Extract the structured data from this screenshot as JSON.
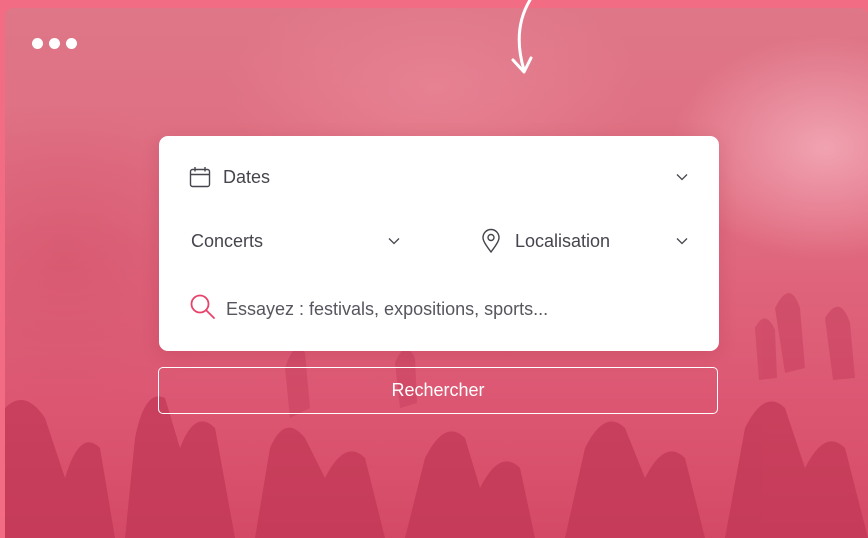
{
  "window": {
    "controls": [
      "dot",
      "dot",
      "dot"
    ]
  },
  "search_form": {
    "dates": {
      "label": "Dates",
      "icon": "calendar-icon"
    },
    "category": {
      "value": "Concerts"
    },
    "location": {
      "label": "Localisation",
      "icon": "location-pin-icon"
    },
    "query": {
      "placeholder": "Essayez : festivals, expositions, sports...",
      "icon": "search-icon"
    }
  },
  "submit": {
    "label": "Rechercher"
  },
  "colors": {
    "background": "#f26d84",
    "accent": "#e8426a",
    "card": "#ffffff",
    "text": "#45454d"
  }
}
